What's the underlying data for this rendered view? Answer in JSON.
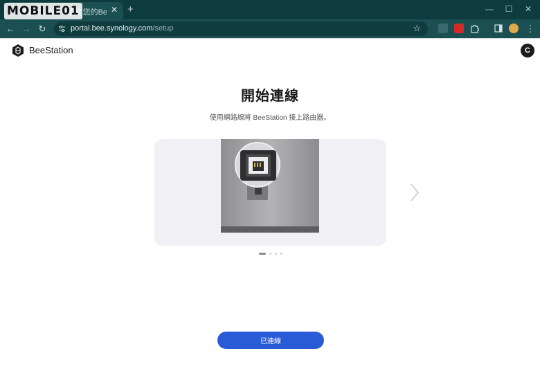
{
  "browser": {
    "tab": {
      "title": "BeeStation · 設定您的BeeStation之旅",
      "close_glyph": "✕"
    },
    "new_tab_glyph": "+",
    "window_controls": {
      "minimize": "—",
      "maximize": "☐",
      "close": "✕"
    },
    "nav": {
      "back": "←",
      "forward": "→",
      "reload": "↻"
    },
    "address": {
      "host": "portal.bee.synology.com",
      "path": "/setup"
    },
    "bookmark_glyph": "☆",
    "menu_glyph": "⋮",
    "icons": [
      "tune-icon",
      "translate-extension-icon",
      "pdf-extension-icon",
      "puzzle-icon",
      "side-panel-icon",
      "profile-icon"
    ]
  },
  "watermark": {
    "text": "MOBILE01"
  },
  "app": {
    "brand": "BeeStation",
    "avatar_letter": "C"
  },
  "setup": {
    "title": "開始連線",
    "subtitle": "使用網路線將 BeeStation 接上路由器。",
    "carousel": {
      "active_index": 0,
      "slide_count": 4
    },
    "primary_button": "已連線"
  },
  "colors": {
    "browser_frame": "#0e3b3e",
    "toolbar": "#1b4f52",
    "primary": "#2a5bd7",
    "carousel_bg": "#f1f1f5",
    "device_body": "#a9a9ab"
  }
}
